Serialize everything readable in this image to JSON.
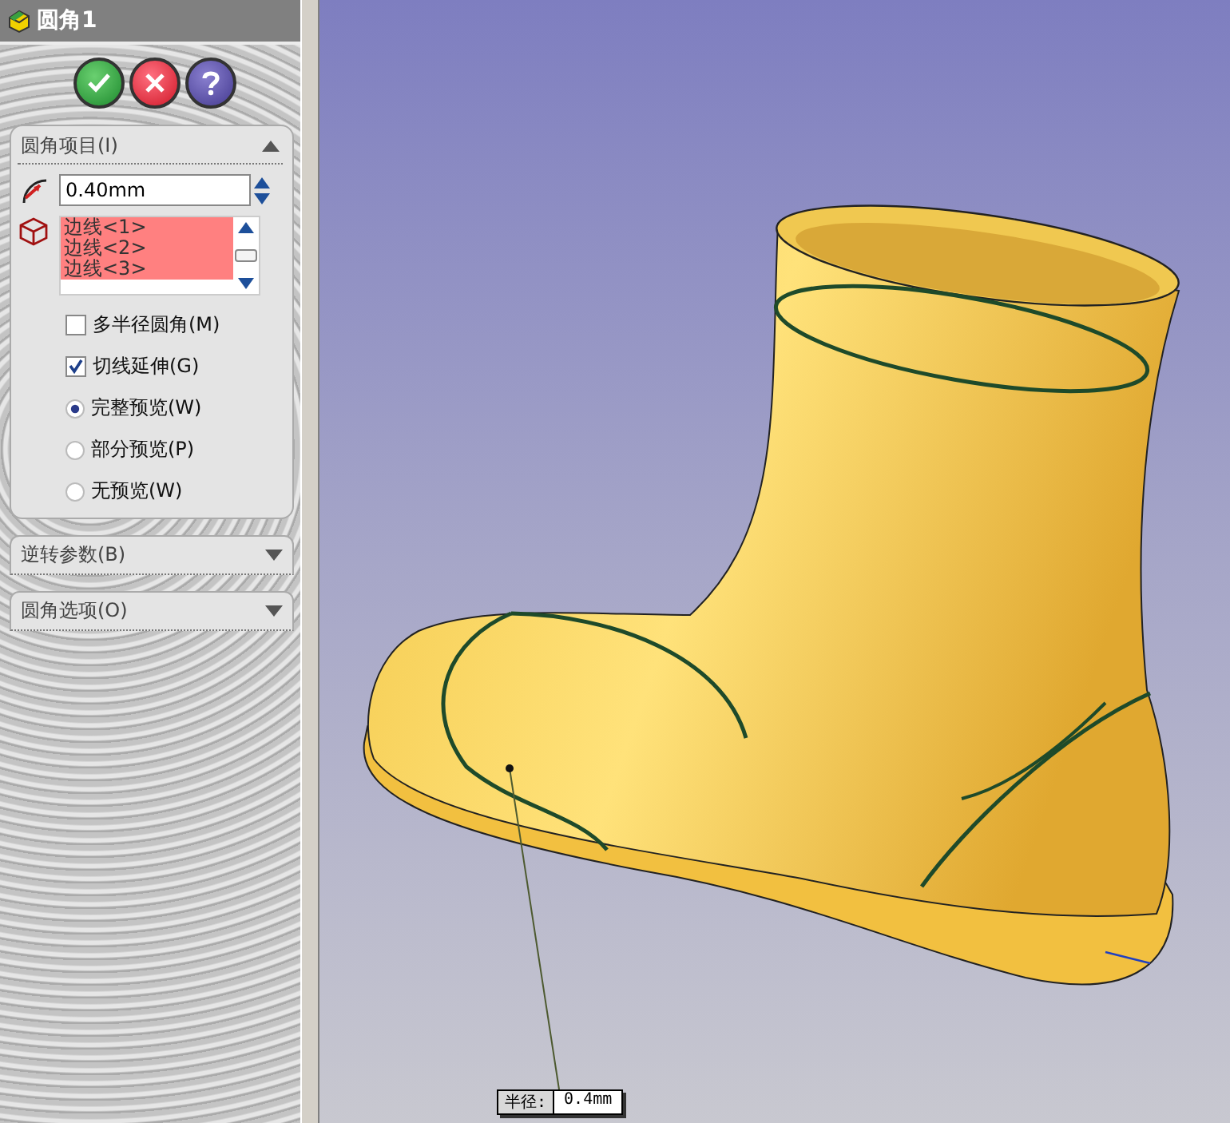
{
  "title": "圆角1",
  "fillet_items": {
    "title": "圆角项目(I)",
    "expanded": true,
    "radius": "0.40mm",
    "edges": [
      {
        "label": "边线<1>",
        "selected": true
      },
      {
        "label": "边线<2>",
        "selected": true
      },
      {
        "label": "边线<3>",
        "selected": true
      }
    ],
    "options": [
      {
        "kind": "checkbox",
        "label": "多半径圆角(M)",
        "checked": false
      },
      {
        "kind": "checkbox",
        "label": "切线延伸(G)",
        "checked": true
      },
      {
        "kind": "radio",
        "label": "完整预览(W)",
        "selected": true
      },
      {
        "kind": "radio",
        "label": "部分预览(P)",
        "selected": false
      },
      {
        "kind": "radio",
        "label": "无预览(W)",
        "selected": false
      }
    ]
  },
  "sections": [
    {
      "title": "逆转参数(B)",
      "expanded": false
    },
    {
      "title": "圆角选项(O)",
      "expanded": false
    }
  ],
  "dimension": {
    "label": "半径:",
    "value": "0.4mm"
  }
}
